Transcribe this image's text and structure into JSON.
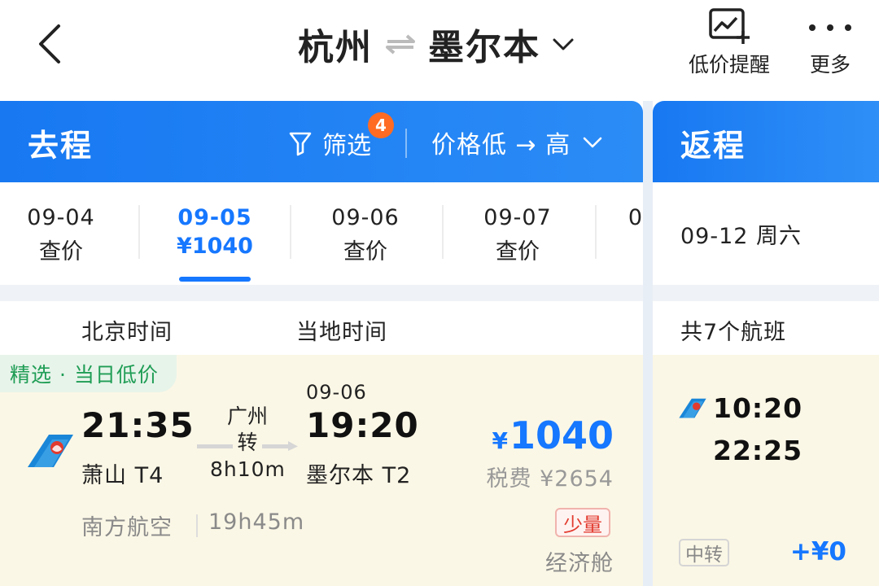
{
  "header": {
    "from_city": "杭州",
    "to_city": "墨尔本",
    "alert_label": "低价提醒",
    "more_label": "更多"
  },
  "outbound": {
    "title": "去程",
    "filter_label": "筛选",
    "filter_count": "4",
    "sort_label": "价格低 → 高",
    "dates": [
      {
        "date": "09-04",
        "price": "查价",
        "selected": false
      },
      {
        "date": "09-05",
        "price": "¥1040",
        "selected": true
      },
      {
        "date": "09-06",
        "price": "查价",
        "selected": false
      },
      {
        "date": "09-07",
        "price": "查价",
        "selected": false
      },
      {
        "date": "0",
        "price": "",
        "selected": false
      }
    ],
    "col_beijing": "北京时间",
    "col_local": "当地时间",
    "flight": {
      "tag": "精选 · 当日低价",
      "depart_time": "21:35",
      "depart_airport": "萧山 T4",
      "via_city": "广州",
      "via_word": "转",
      "layover": "8h10m",
      "arrive_date": "09-06",
      "arrive_time": "19:20",
      "arrive_airport": "墨尔本 T2",
      "currency": "¥",
      "price": "1040",
      "tax": "税费 ¥2654",
      "airline": "南方航空",
      "total_duration": "19h45m",
      "seats": "少量",
      "cabin": "经济舱"
    }
  },
  "return": {
    "title": "返程",
    "date": "09-12 周六",
    "count": "共7个航班",
    "flight": {
      "depart_time": "10:20",
      "arrive_time": "22:25",
      "transfer": "中转",
      "price_diff": "+¥0"
    }
  },
  "colors": {
    "brand_blue": "#1677ff",
    "card_bg": "#fbf7e6",
    "tag_green": "#1f9d55",
    "badge_orange": "#ff6b22",
    "warning_red": "#e23a2e"
  },
  "icons": [
    "back-arrow-icon",
    "swap-icon",
    "chevron-down-icon",
    "price-alert-chart-icon",
    "more-dots-icon",
    "filter-funnel-icon",
    "china-southern-logo-icon"
  ]
}
